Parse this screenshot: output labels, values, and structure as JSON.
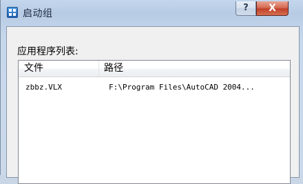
{
  "window": {
    "title": "启动组",
    "help_label": "?",
    "close_label": "X"
  },
  "list": {
    "label": "应用程序列表:",
    "columns": [
      "文件",
      "路径"
    ],
    "rows": [
      {
        "file": "zbbz.VLX",
        "path": "F:\\Program Files\\AutoCAD 2004..."
      }
    ]
  },
  "colors": {
    "titlebar": "#c3d6ec",
    "close_button": "#c2402a",
    "client_background": "#f0f0f0"
  },
  "icons": [
    "app-icon",
    "help-icon",
    "close-icon"
  ]
}
